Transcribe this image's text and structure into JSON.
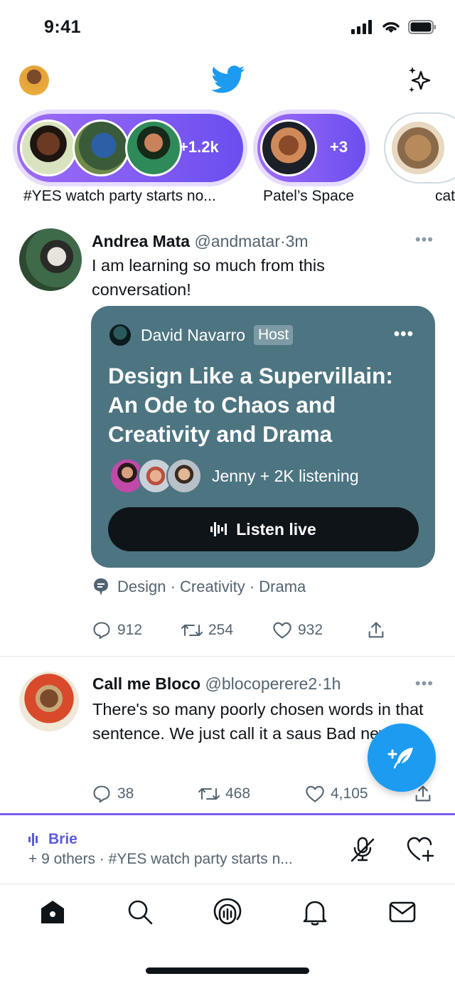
{
  "status_bar": {
    "time": "9:41"
  },
  "spaces": [
    {
      "count": "+1.2k",
      "caption": "#YES watch party starts no..."
    },
    {
      "count": "+3",
      "caption": "Patel’s Space"
    },
    {
      "caption": "cat"
    }
  ],
  "tweets": [
    {
      "name": "Andrea Mata",
      "handle": "@andmatar",
      "time": "3m",
      "text": "I am learning so much from this conversation!",
      "space_card": {
        "host_name": "David Navarro",
        "host_badge": "Host",
        "title": "Design Like a Supervillain: An Ode to Chaos and Creativity and Drama",
        "listeners": "Jenny + 2K listening",
        "button": "Listen live"
      },
      "topics": "Design · Creativity · Drama",
      "replies": "912",
      "retweets": "254",
      "likes": "932"
    },
    {
      "name": "Call me Bloco",
      "handle": "@blocoperere2",
      "time": "1h",
      "text": "There's so many poorly chosen words in that sentence. We just call it a saus Bad news.",
      "replies": "38",
      "retweets": "468",
      "likes": "4,105"
    }
  ],
  "dock": {
    "name": "Brie",
    "subtitle": "+ 9 others · #YES watch party starts n..."
  },
  "colors": {
    "accent": "#1d9bf0",
    "space_purple": "#7a5af5",
    "card_bg": "#4d7481"
  }
}
